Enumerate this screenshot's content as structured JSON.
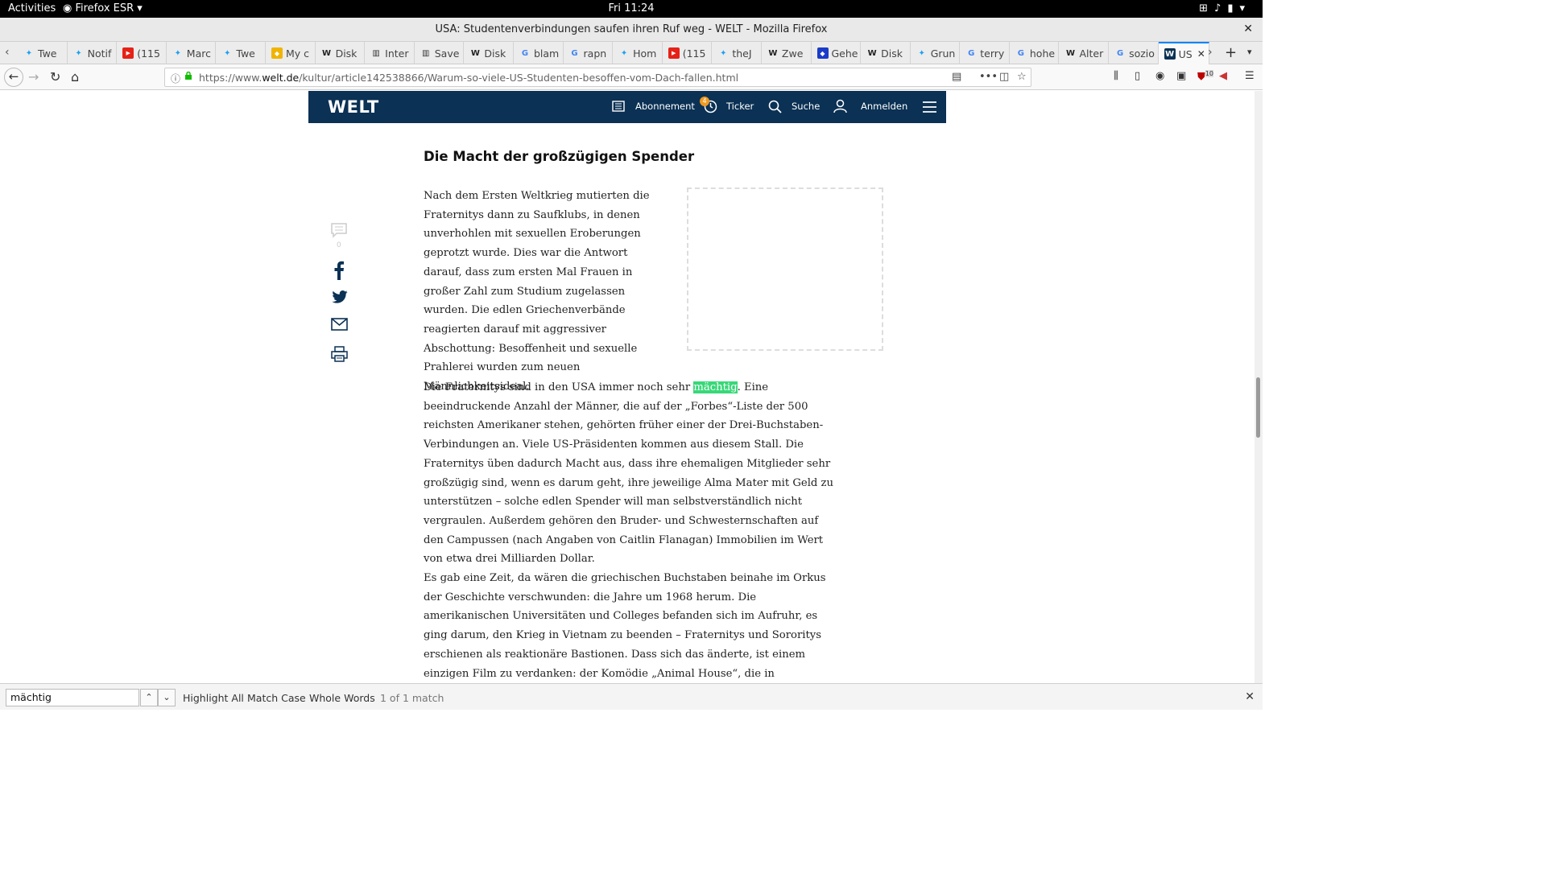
{
  "gnome": {
    "activities": "Activities",
    "app_menu": "Firefox ESR",
    "clock": "Fri 11:24"
  },
  "window": {
    "title": "USA: Studentenverbindungen saufen ihren Ruf weg - WELT - Mozilla Firefox"
  },
  "tabs": [
    {
      "label": "Twe",
      "icon": "twitter-icon",
      "color": "#1da1f2"
    },
    {
      "label": "Notif",
      "icon": "twitter-icon",
      "color": "#1da1f2"
    },
    {
      "label": "(115",
      "icon": "youtube-icon",
      "color": "#e62117"
    },
    {
      "label": "Marc",
      "icon": "twitter-icon",
      "color": "#1da1f2"
    },
    {
      "label": "Twe",
      "icon": "twitter-icon",
      "color": "#1da1f2"
    },
    {
      "label": "My c",
      "icon": "generic-icon",
      "color": "#f0b400"
    },
    {
      "label": "Disk",
      "icon": "wikipedia-icon",
      "color": "#222222"
    },
    {
      "label": "Inter",
      "icon": "archive-icon",
      "color": "#333333"
    },
    {
      "label": "Save",
      "icon": "archive-icon",
      "color": "#333333"
    },
    {
      "label": "Disk",
      "icon": "wikipedia-icon",
      "color": "#222222"
    },
    {
      "label": "blam",
      "icon": "google-icon",
      "color": "#4285f4"
    },
    {
      "label": "rapn",
      "icon": "google-icon",
      "color": "#4285f4"
    },
    {
      "label": "Hom",
      "icon": "twitter-icon",
      "color": "#1da1f2"
    },
    {
      "label": "(115",
      "icon": "youtube-icon",
      "color": "#e62117"
    },
    {
      "label": "theJ",
      "icon": "twitter-icon",
      "color": "#1da1f2"
    },
    {
      "label": "Zwe",
      "icon": "wikipedia-icon",
      "color": "#222222"
    },
    {
      "label": "Gehe",
      "icon": "generic-icon",
      "color": "#1a3cc8"
    },
    {
      "label": "Disk",
      "icon": "wikipedia-icon",
      "color": "#222222"
    },
    {
      "label": "Grun",
      "icon": "twitter-icon",
      "color": "#1da1f2"
    },
    {
      "label": "terry",
      "icon": "google-icon",
      "color": "#4285f4"
    },
    {
      "label": "hohe",
      "icon": "google-icon",
      "color": "#4285f4"
    },
    {
      "label": "Alter",
      "icon": "wikipedia-icon",
      "color": "#222222"
    },
    {
      "label": "sozio",
      "icon": "google-icon",
      "color": "#4285f4"
    },
    {
      "label": "US",
      "icon": "welt-icon",
      "color": "#0b3154",
      "active": true
    }
  ],
  "nav": {
    "url_prefix": "https://www.",
    "url_domain": "welt.de",
    "url_path": "/kultur/article142538866/Warum-so-viele-US-Studenten-besoffen-vom-Dach-fallen.html",
    "addon_badge": "10"
  },
  "site_header": {
    "logo": "WELT",
    "abonnement": "Abonnement",
    "ticker": "Ticker",
    "ticker_badge": "4",
    "suche": "Suche",
    "anmelden": "Anmelden"
  },
  "article": {
    "subheading": "Die Macht der großzügigen Spender",
    "comment_count": "0",
    "p1": "Nach dem Ersten Weltkrieg mutierten die Fraternitys dann zu Saufklubs, in denen unverhohlen mit sexuellen Eroberungen geprotzt wurde. Dies war die Antwort darauf, dass zum ersten Mal Frauen in großer Zahl zum Studium zugelassen wurden. Die edlen Griechenverbände reagierten darauf mit aggressiver Abschottung: Besoffenheit und sexuelle Prahlerei wurden zum neuen Männlichkeitsideal.",
    "p2_before": "Die Fraternitys sind in den USA immer noch sehr ",
    "p2_match": "mächtig",
    "p2_after": ". Eine beeindruckende Anzahl der Männer, die auf der „Forbes“-Liste der 500 reichsten Amerikaner stehen, gehörten früher einer der Drei-Buchstaben-Verbindungen an. Viele US-Präsidenten kommen aus diesem Stall. Die Fraternitys üben dadurch Macht aus, dass ihre ehemaligen Mitglieder sehr großzügig sind, wenn es darum geht, ihre jeweilige Alma Mater mit Geld zu unterstützen – solche edlen Spender will man selbstverständlich nicht vergraulen. Außerdem gehören den Bruder- und Schwesternschaften auf den Campussen (nach Angaben von Caitlin Flanagan) Immobilien im Wert von etwa drei Milliarden Dollar.",
    "p3": "Es gab eine Zeit, da wären die griechischen Buchstaben beinahe im Orkus der Geschichte verschwunden: die Jahre um 1968 herum. Die amerikanischen Universitäten und Colleges befanden sich im Aufruhr, es ging darum, den Krieg in Vietnam zu beenden – Fraternitys und Sororitys erschienen als reaktionäre Bastionen. Dass sich das änderte, ist einem einzigen Film zu verdanken: der Komödie „Animal House“, die in Deutschland unter dem dämlichen Titel „Ich glaub,"
  },
  "findbar": {
    "query": "mächtig",
    "highlight_all": "Highlight All",
    "match_case": "Match Case",
    "whole_words": "Whole Words",
    "status": "1 of 1 match"
  },
  "colors": {
    "welt_navy": "#0b3154",
    "find_highlight": "#38d878",
    "tab_active_accent": "#0a84ff"
  }
}
